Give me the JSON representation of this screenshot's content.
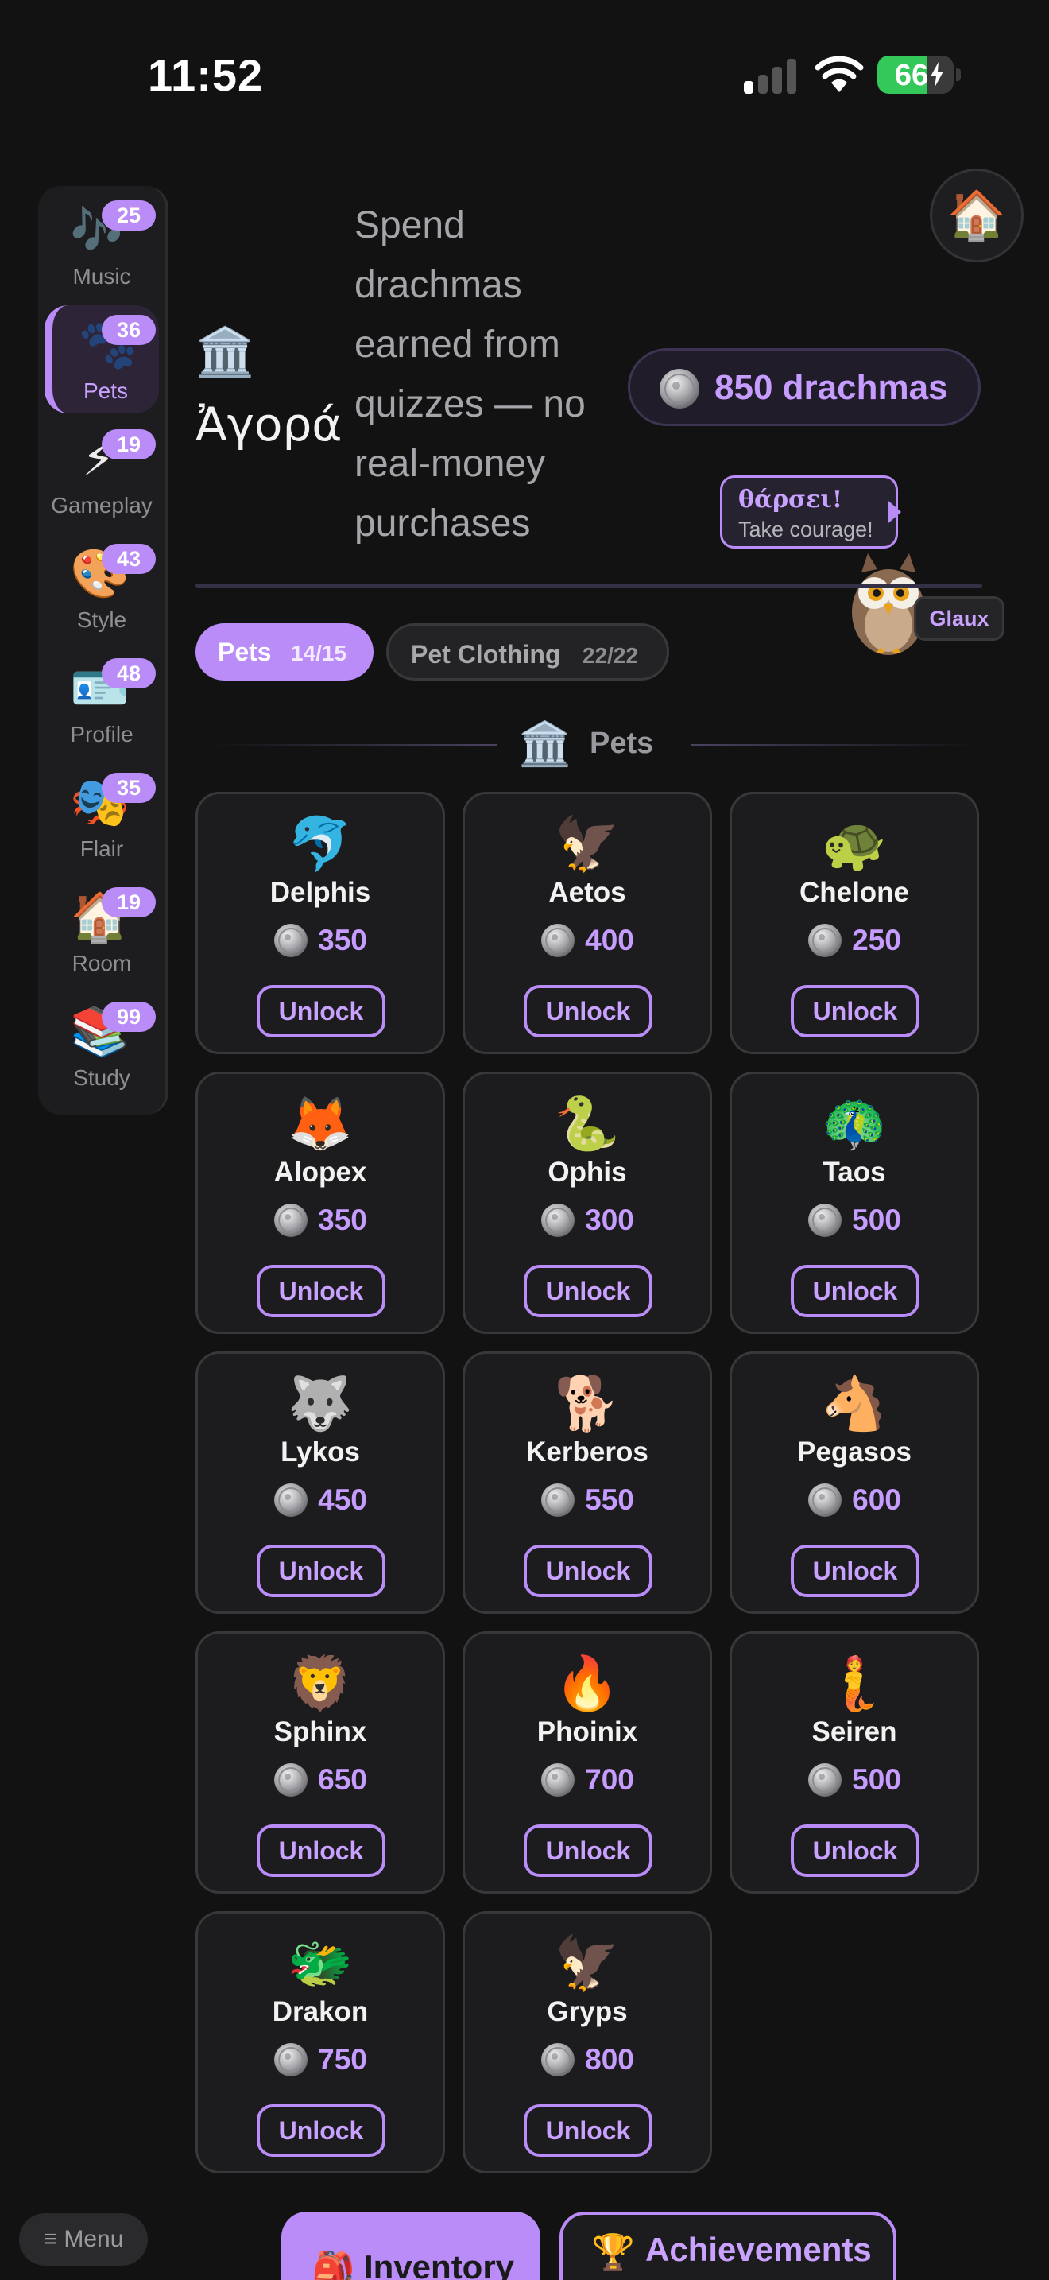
{
  "status_bar": {
    "time": "11:52",
    "battery_percent": 66,
    "battery_label": "66"
  },
  "sidebar": {
    "items": [
      {
        "key": "music",
        "label": "Music",
        "icon": "music-notes-icon",
        "emoji": "🎶",
        "badge": "25",
        "active": false
      },
      {
        "key": "pets",
        "label": "Pets",
        "icon": "paw-prints-icon",
        "emoji": "🐾",
        "badge": "36",
        "active": true
      },
      {
        "key": "gameplay",
        "label": "Gameplay",
        "icon": "lightning-icon",
        "emoji": "⚡",
        "badge": "19",
        "active": false
      },
      {
        "key": "style",
        "label": "Style",
        "icon": "palette-icon",
        "emoji": "🎨",
        "badge": "43",
        "active": false
      },
      {
        "key": "profile",
        "label": "Profile",
        "icon": "id-card-icon",
        "emoji": "🪪",
        "badge": "48",
        "active": false
      },
      {
        "key": "flair",
        "label": "Flair",
        "icon": "theater-masks-icon",
        "emoji": "🎭",
        "badge": "35",
        "active": false
      },
      {
        "key": "room",
        "label": "Room",
        "icon": "house-icon",
        "emoji": "🏠",
        "badge": "19",
        "active": false
      },
      {
        "key": "study",
        "label": "Study",
        "icon": "books-icon",
        "emoji": "📚",
        "badge": "99",
        "active": false
      }
    ]
  },
  "home_button": {
    "icon": "house-icon",
    "emoji": "🏠"
  },
  "header": {
    "icon": "classical-building-icon",
    "icon_emoji": "🏛️",
    "title": "Ἀγορά",
    "description": "Spend drachmas earned from quizzes — no real-money purchases",
    "balance": "850 drachmas"
  },
  "mascot": {
    "bubble_greek": "θάρσει!",
    "bubble_english": "Take courage!",
    "name": "Glaux",
    "icon": "owl-icon"
  },
  "tabs": [
    {
      "label": "Pets",
      "count": "14/15",
      "active": true
    },
    {
      "label": "Pet Clothing",
      "count": "22/22",
      "active": false
    }
  ],
  "section": {
    "title": "Pets",
    "icon_emoji": "🏛️"
  },
  "unlock_label": "Unlock",
  "pets": [
    {
      "name": "Delphis",
      "emoji": "🐬",
      "price": "350"
    },
    {
      "name": "Aetos",
      "emoji": "🦅",
      "price": "400"
    },
    {
      "name": "Chelone",
      "emoji": "🐢",
      "price": "250"
    },
    {
      "name": "Alopex",
      "emoji": "🦊",
      "price": "350"
    },
    {
      "name": "Ophis",
      "emoji": "🐍",
      "price": "300"
    },
    {
      "name": "Taos",
      "emoji": "🦚",
      "price": "500"
    },
    {
      "name": "Lykos",
      "emoji": "🐺",
      "price": "450"
    },
    {
      "name": "Kerberos",
      "emoji": "🐕",
      "price": "550"
    },
    {
      "name": "Pegasos",
      "emoji": "🐴",
      "price": "600"
    },
    {
      "name": "Sphinx",
      "emoji": "🦁",
      "price": "650"
    },
    {
      "name": "Phoinix",
      "emoji": "🔥",
      "price": "700"
    },
    {
      "name": "Seiren",
      "emoji": "🧜",
      "price": "500"
    },
    {
      "name": "Drakon",
      "emoji": "🐲",
      "price": "750"
    },
    {
      "name": "Gryps",
      "emoji": "🦅",
      "price": "800"
    }
  ],
  "bottom": {
    "menu_label": "≡ Menu",
    "inventory_label": "Inventory",
    "inventory_emoji": "🎒",
    "achievements_label": "Achievements",
    "achievements_emoji": "🏆"
  },
  "colors": {
    "accent": "#b98cf7",
    "accent_text": "#c79cff",
    "background": "#121212",
    "card": "#1c1c1e",
    "battery_green": "#34c759"
  }
}
